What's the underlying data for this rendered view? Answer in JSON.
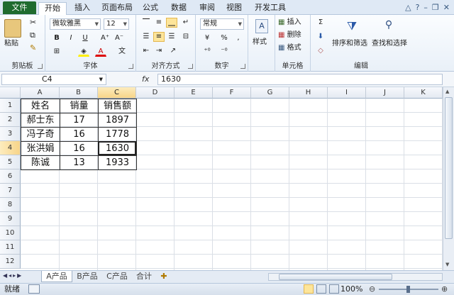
{
  "tabs": {
    "file": "文件",
    "items": [
      "开始",
      "插入",
      "页面布局",
      "公式",
      "数据",
      "审阅",
      "视图",
      "开发工具"
    ]
  },
  "ribbon": {
    "clipboard": {
      "label": "剪贴板",
      "paste": "粘贴"
    },
    "font": {
      "label": "字体",
      "family": "微软雅黑",
      "size": "12"
    },
    "alignment": {
      "label": "对齐方式"
    },
    "number": {
      "label": "数字",
      "format": "常规",
      "percent": "%",
      "comma": ","
    },
    "styles": {
      "label": "样式"
    },
    "cells": {
      "label": "单元格",
      "insert": "插入",
      "delete": "删除",
      "format": "格式"
    },
    "editing": {
      "label": "编辑",
      "sort_filter": "排序和筛选",
      "find_select": "查找和选择"
    }
  },
  "formula_bar": {
    "name_box": "C4",
    "fx": "fx",
    "value": "1630"
  },
  "grid": {
    "columns": [
      "A",
      "B",
      "C",
      "D",
      "E",
      "F",
      "G",
      "H",
      "I",
      "J",
      "K"
    ],
    "rows": [
      "1",
      "2",
      "3",
      "4",
      "5",
      "6",
      "7",
      "8",
      "9",
      "10",
      "11",
      "12"
    ],
    "data": [
      [
        "姓名",
        "销量",
        "销售额"
      ],
      [
        "郝士东",
        "17",
        "1897"
      ],
      [
        "冯子奇",
        "16",
        "1778"
      ],
      [
        "张洪娟",
        "16",
        "1630"
      ],
      [
        "陈诚",
        "13",
        "1933"
      ]
    ]
  },
  "sheets": [
    "A产品",
    "B产品",
    "C产品",
    "合计"
  ],
  "status": {
    "ready": "就绪",
    "zoom": "100%"
  }
}
